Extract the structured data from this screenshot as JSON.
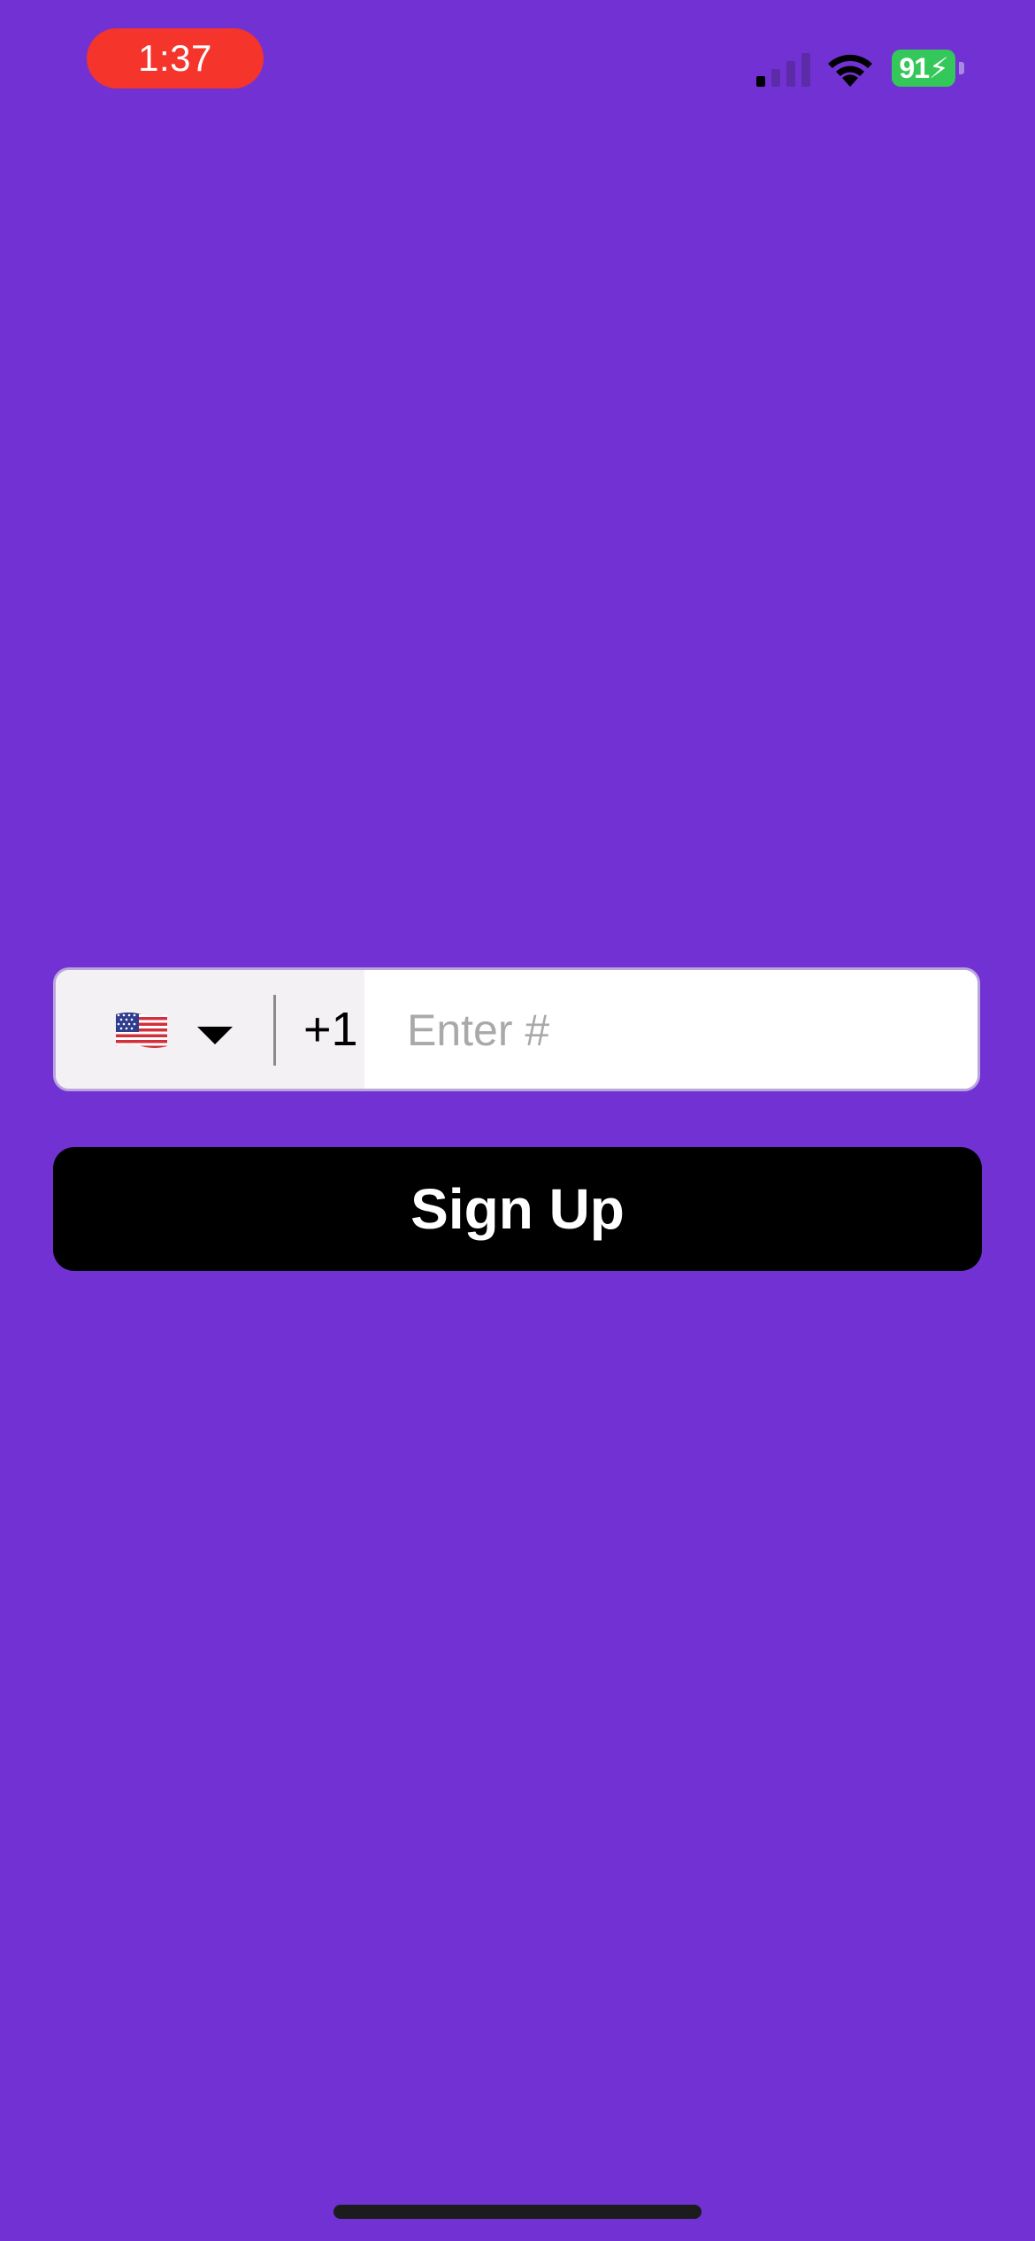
{
  "status_bar": {
    "time": "1:37",
    "battery_level": "91",
    "signal_bars_active": 1,
    "signal_bars_total": 4,
    "colors": {
      "time_pill": "#f5342b",
      "battery": "#34c759"
    }
  },
  "phone_field": {
    "country_flag_icon": "us-flag-icon",
    "dropdown_icon": "caret-down-icon",
    "dial_code": "+1",
    "number_value": "",
    "number_placeholder": "Enter #"
  },
  "signup": {
    "label": "Sign Up"
  },
  "theme": {
    "background": "#7232d3",
    "button": "#000000"
  }
}
